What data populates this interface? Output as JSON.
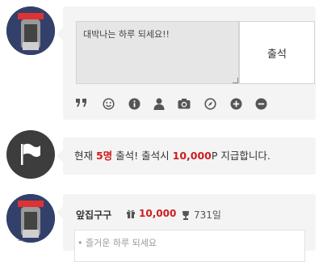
{
  "composer": {
    "message_value": "대박나는 하루 되세요!!",
    "submit_label": "출석",
    "toolbar_icons": [
      "quote-icon",
      "smiley-icon",
      "info-icon",
      "user-icon",
      "camera-icon",
      "compass-icon",
      "plus-circle-icon",
      "minus-circle-icon"
    ]
  },
  "notice": {
    "prefix": "현재 ",
    "count": "5명",
    "middle": " 출석! 출석시 ",
    "points": "10,000",
    "suffix": "P 지급합니다."
  },
  "entries": [
    {
      "name": "앞집구구",
      "points": "10,000",
      "days": "731일",
      "message_partial": "• 즐거운 하루 되세요"
    }
  ],
  "colors": {
    "highlight": "#cc1f1f",
    "card_bg": "#f4f4f4",
    "icon": "#555555"
  }
}
